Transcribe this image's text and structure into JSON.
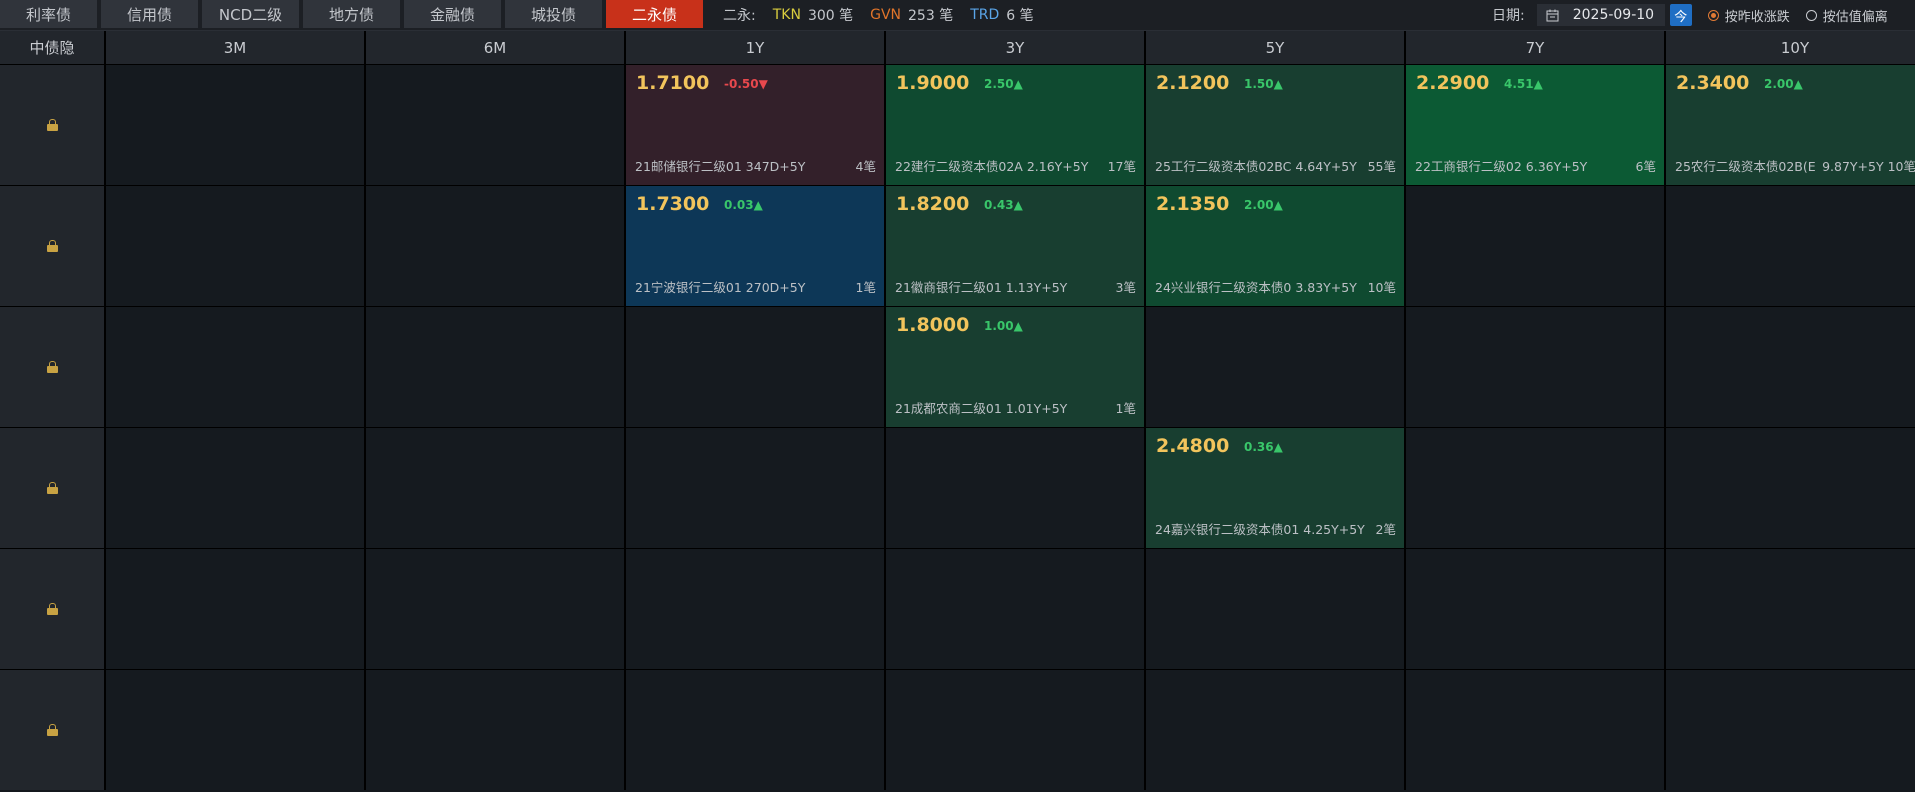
{
  "tabs": [
    {
      "label": "利率债"
    },
    {
      "label": "信用债"
    },
    {
      "label": "NCD二级"
    },
    {
      "label": "地方债"
    },
    {
      "label": "金融债"
    },
    {
      "label": "城投债"
    },
    {
      "label": "二永债",
      "active": true
    }
  ],
  "stats": {
    "label": "二永:",
    "tkn_label": "TKN",
    "tkn_value": "300 笔",
    "gvn_label": "GVN",
    "gvn_value": "253 笔",
    "trd_label": "TRD",
    "trd_value": "6 笔"
  },
  "date_filter": {
    "label": "日期:",
    "value": "2025-09-10",
    "today_button": "今",
    "radio_options": [
      {
        "label": "按昨收涨跌",
        "checked": true
      },
      {
        "label": "按估值偏离",
        "checked": false
      }
    ]
  },
  "grid": {
    "corner_label": "中债隐",
    "columns": [
      "3M",
      "6M",
      "1Y",
      "3Y",
      "5Y",
      "7Y",
      "10Y"
    ],
    "rows": 6,
    "quotes": [
      {
        "row": 0,
        "col": 2,
        "yield": "1.7100",
        "change": "-0.50▼",
        "direction": "down",
        "bond": "21邮储银行二级01 347D+5Y",
        "count": "4笔",
        "tone": "red"
      },
      {
        "row": 0,
        "col": 3,
        "yield": "1.9000",
        "change": "2.50▲",
        "direction": "up",
        "bond": "22建行二级资本债02A 2.16Y+5Y",
        "count": "17笔",
        "tone": "green1"
      },
      {
        "row": 0,
        "col": 4,
        "yield": "2.1200",
        "change": "1.50▲",
        "direction": "up",
        "bond": "25工行二级资本债02BC 4.64Y+5Y",
        "count": "55笔",
        "tone": "green3"
      },
      {
        "row": 0,
        "col": 5,
        "yield": "2.2900",
        "change": "4.51▲",
        "direction": "up",
        "bond": "22工商银行二级02 6.36Y+5Y",
        "count": "6笔",
        "tone": "green2"
      },
      {
        "row": 0,
        "col": 6,
        "yield": "2.3400",
        "change": "2.00▲",
        "direction": "up",
        "bond": "25农行二级资本债02B(E",
        "count": "9.87Y+5Y 10笔",
        "tone": "green3"
      },
      {
        "row": 1,
        "col": 2,
        "yield": "1.7300",
        "change": "0.03▲",
        "direction": "up",
        "bond": "21宁波银行二级01 270D+5Y",
        "count": "1笔",
        "tone": "blue"
      },
      {
        "row": 1,
        "col": 3,
        "yield": "1.8200",
        "change": "0.43▲",
        "direction": "up",
        "bond": "21徽商银行二级01 1.13Y+5Y",
        "count": "3笔",
        "tone": "green3"
      },
      {
        "row": 1,
        "col": 4,
        "yield": "2.1350",
        "change": "2.00▲",
        "direction": "up",
        "bond": "24兴业银行二级资本债0 3.83Y+5Y",
        "count": "10笔",
        "tone": "green1"
      },
      {
        "row": 2,
        "col": 3,
        "yield": "1.8000",
        "change": "1.00▲",
        "direction": "up",
        "bond": "21成都农商二级01 1.01Y+5Y",
        "count": "1笔",
        "tone": "green3"
      },
      {
        "row": 3,
        "col": 4,
        "yield": "2.4800",
        "change": "0.36▲",
        "direction": "up",
        "bond": "24嘉兴银行二级资本债01 4.25Y+5Y",
        "count": "2笔",
        "tone": "green3"
      }
    ]
  }
}
